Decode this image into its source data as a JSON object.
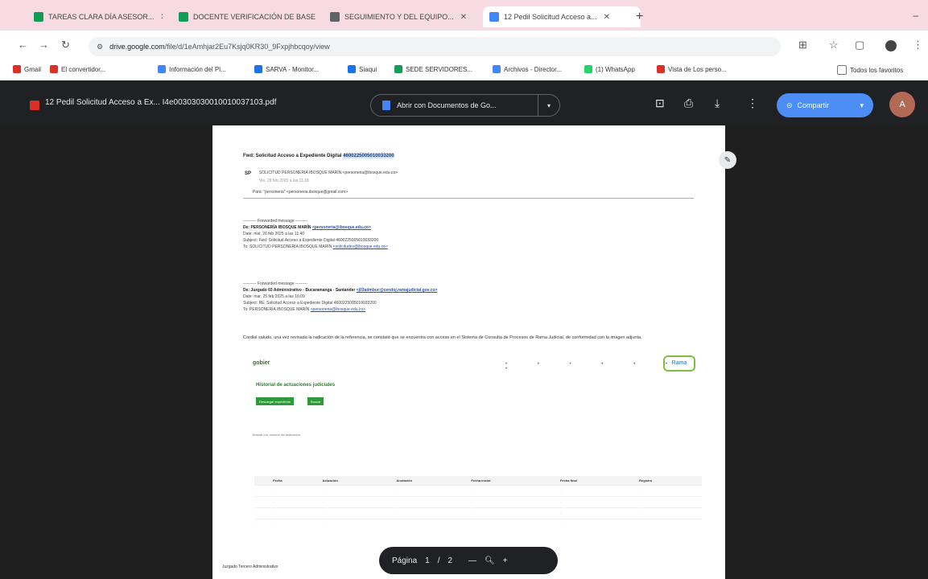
{
  "browser": {
    "tabs": [
      {
        "title": "TAREAS CLARA DÍA ASESOR...",
        "color": "#0f9d58"
      },
      {
        "title": "DOCENTE VERIFICACIÓN DE BASE...",
        "color": "#0f9d58"
      },
      {
        "title": "SEGUIMIENTO Y DEL EQUIPO...",
        "color": "#5f6368"
      },
      {
        "title": "12 Pedil Solicitud Acceso a...",
        "color": "#4285f4",
        "active": true
      }
    ],
    "new_tab": "+",
    "minimize": "–",
    "url_host": "drive.google.com",
    "url_path": "/file/d/1eAmhjar2Eu7Ksjq0KR30_9Fxpjhbcqoy/view",
    "bookmarks": [
      {
        "label": "Gmail",
        "color": "#d93025"
      },
      {
        "label": "El convertidor...",
        "color": "#d93025"
      },
      {
        "label": "Información del Pl...",
        "color": "#4285f4"
      },
      {
        "label": "SARVA - Monitor...",
        "color": "#1a73e8"
      },
      {
        "label": "Siaqui",
        "color": "#1a73e8"
      },
      {
        "label": "SEDE SERVIDORES...",
        "color": "#0f9d58"
      },
      {
        "label": "Archivos - Director...",
        "color": "#4285f4"
      },
      {
        "label": "(1) WhatsApp",
        "color": "#25d366"
      },
      {
        "label": "Vista de Los perso...",
        "color": "#d93025"
      }
    ],
    "all_bookmarks": "Todos los favoritos"
  },
  "viewer": {
    "filename": "12 Pedil Solicitud Acceso a Ex... I4e00303030010010037103.pdf",
    "open_with": "Abrir con Documentos de Go...",
    "share_label": "Compartir",
    "avatar_letter": "A"
  },
  "document": {
    "subject_prefix": "Fwd: Solicitud Acceso a Expediente Digital",
    "subject_highlight": "4600225005010033200",
    "sender_initials": "SP",
    "sender_line": "SOLICITUD PERSONERÍA IBOSQUE MARÍN <personeria@ibosque.edu.co>",
    "sender_sub": "Vie, 28 feb 2025 a las 11:18",
    "to_line": "Para: \"personeria\" <personeria.ibosque@gmail.com>",
    "fwd1": {
      "header": "---------- Forwarded message ---------",
      "from": "De: PERSONERÍA IBOSQUE MARÍN",
      "from_email": "<personeria@ibosque.edu.co>",
      "date": "Date: mié, 26 feb 2025 a las 11:40",
      "subject": "Subject: Fwd: Solicitud Acceso a Expediente Digital 4600225005010033200",
      "to": "To: SOLICITUD PERSONERÍA IBOSQUE MARÍN",
      "to_email": "<solicitudes@ibosque.edu.co>"
    },
    "fwd2": {
      "header": "---------- Forwarded message ---------",
      "from": "De: Juzgado 03 Administrativo - Bucaramanga - Santander",
      "from_email": "<j03admbuc@cendoj.ramajudicial.gov.co>",
      "date": "Date: mar, 25 feb 2025 a las 16:09",
      "subject": "Subject: RE: Solicitud Acceso a Expediente Digital 4600225005010033200",
      "to": "To: PERSONERÍA IBOSQUE MARÍN",
      "to_email": "<personeria@ibosque.edu.co>"
    },
    "body": "Cordial saludo, una vez revisada la radicación de la referencia, se constató que se encuentra con acceso en el Sistema de Consulta de Procesos de Rama Judicial, de conformidad con la imagen adjunta.",
    "shot": {
      "title": "Historial de actuaciones judiciales",
      "btn1": "Descargar expediente",
      "btn2": "Buscar",
      "search": "Buscar por número de radicación",
      "logo_right": "Rama",
      "columns": [
        "",
        "Fecha",
        "Actuación",
        "Anotación",
        "Fecha inicial",
        "Fecha final",
        "Registro"
      ]
    },
    "footer": "Juzgado Tercero Administrativo"
  },
  "pager": {
    "label": "Página",
    "current": "1",
    "separator": "/",
    "total": "2",
    "minus": "—",
    "zoom_icon": "search-icon",
    "plus": "+"
  }
}
